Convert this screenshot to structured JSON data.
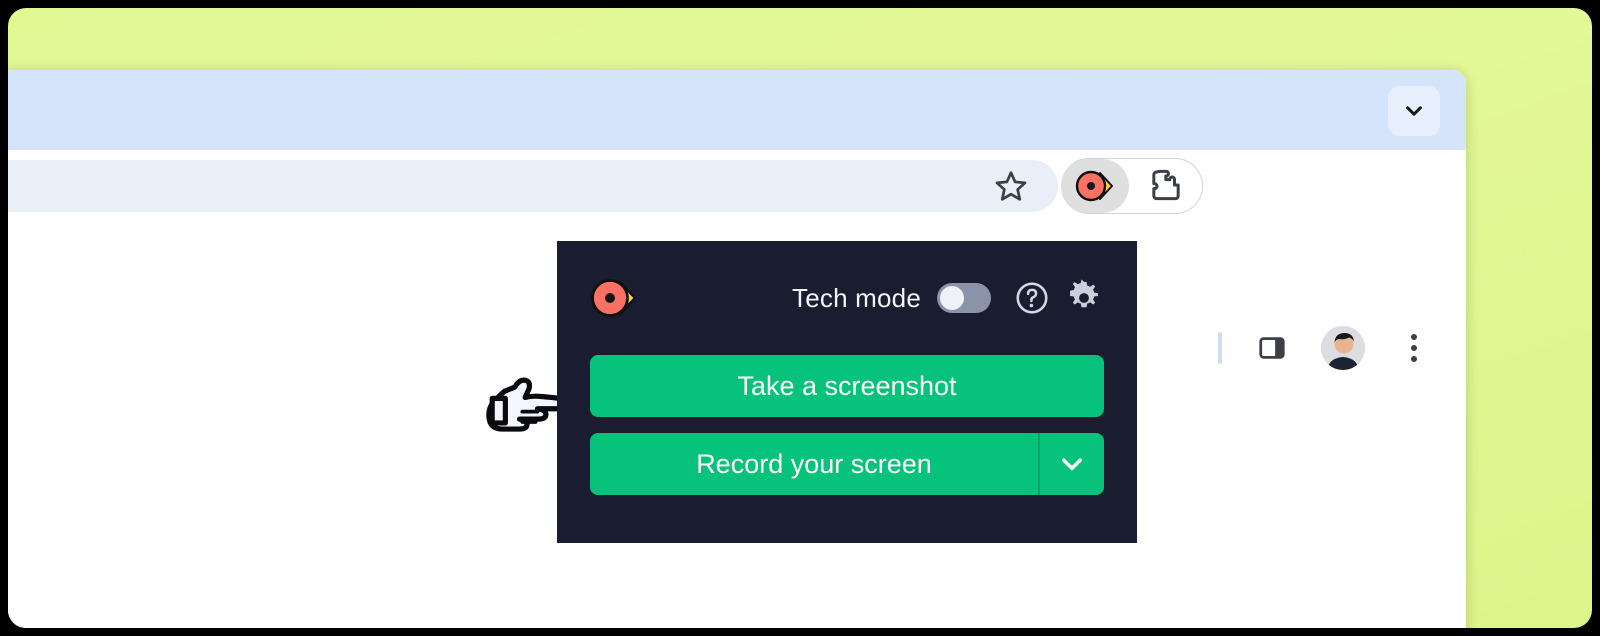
{
  "window": {
    "backdrop_color": "#e2f898",
    "browser_chrome_color": "#ffffff",
    "tabstrip_color": "#d6e4fb"
  },
  "browser_toolbar": {
    "omnibox": {
      "value": "",
      "placeholder": ""
    },
    "bookmark_icon": "star-icon",
    "extension_pill": {
      "active_extension_icon": "recorder-logo-icon",
      "extensions_icon": "puzzle-piece-icon"
    },
    "side_panel_icon": "side-panel-icon",
    "avatar_icon": "profile-avatar",
    "menu_icon": "three-dot-menu-icon",
    "tab_collapse_icon": "chevron-down-icon"
  },
  "popup": {
    "logo_icon": "recorder-logo-icon",
    "tech_mode_label": "Tech mode",
    "tech_mode_enabled": false,
    "help_icon": "question-circle-icon",
    "settings_icon": "gear-icon",
    "screenshot_button_label": "Take a screenshot",
    "record_button_label": "Record your screen",
    "record_dropdown_icon": "chevron-down-icon",
    "accent_color": "#06c27a",
    "panel_color": "#191d2f",
    "toggle_track_color": "#8a93aa"
  },
  "annotation": {
    "pointer_icon": "pointing-hand-icon"
  }
}
